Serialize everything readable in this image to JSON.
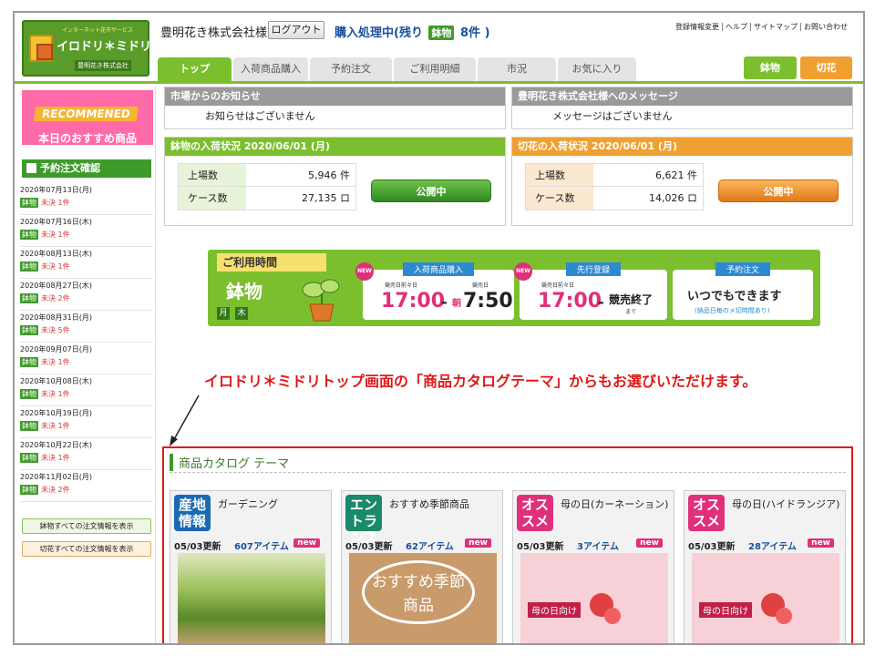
{
  "header": {
    "logo_tagline": "インターネット花市サービス",
    "logo_name": "イロドリ＊ミドリ",
    "logo_company": "豊明花き株式会社",
    "company_name": "豊明花き株式会社様",
    "logout_label": "ログアウト",
    "status_prefix": "購入処理中(残り",
    "status_tag": "鉢物",
    "status_count": "8件 )",
    "toplinks": [
      "登録情報変更",
      "ヘルプ",
      "サイトマップ",
      "お問い合わせ"
    ]
  },
  "tabs": [
    {
      "label": "トップ",
      "active": true
    },
    {
      "label": "入荷商品購入"
    },
    {
      "label": "予約注文"
    },
    {
      "label": "ご利用明細"
    },
    {
      "label": "市況"
    },
    {
      "label": "お気に入り"
    }
  ],
  "category_buttons": {
    "hachi": "鉢物",
    "kiri": "切花"
  },
  "sidebar": {
    "recommend_label": "RECOMMENED",
    "recommend_sub": "本日のおすすめ商品",
    "order_header": "予約注文確認",
    "orders": [
      {
        "date": "2020年07月13日(月)",
        "type": "鉢物",
        "status": "未決 1件"
      },
      {
        "date": "2020年07月16日(木)",
        "type": "鉢物",
        "status": "未決 1件"
      },
      {
        "date": "2020年08月13日(木)",
        "type": "鉢物",
        "status": "未決 1件"
      },
      {
        "date": "2020年08月27日(木)",
        "type": "鉢物",
        "status": "未決 2件"
      },
      {
        "date": "2020年08月31日(月)",
        "type": "鉢物",
        "status": "未決 5件"
      },
      {
        "date": "2020年09月07日(月)",
        "type": "鉢物",
        "status": "未決 1件"
      },
      {
        "date": "2020年10月08日(木)",
        "type": "鉢物",
        "status": "未決 1件"
      },
      {
        "date": "2020年10月19日(月)",
        "type": "鉢物",
        "status": "未決 1件"
      },
      {
        "date": "2020年10月22日(木)",
        "type": "鉢物",
        "status": "未決 1件"
      },
      {
        "date": "2020年11月02日(月)",
        "type": "鉢物",
        "status": "未決 2件"
      }
    ],
    "btn_hachi_all": "鉢物すべての注文情報を表示",
    "btn_kiri_all": "切花すべての注文情報を表示"
  },
  "notices": {
    "market_title": "市場からのお知らせ",
    "market_body": "お知らせはございません",
    "message_title": "豊明花き株式会社様へのメッセージ",
    "message_body": "メッセージはございません"
  },
  "arrivals": {
    "hachi_title": "鉢物の入荷状況 2020/06/01 (月)",
    "hachi_rows": [
      {
        "label": "上場数",
        "value": "5,946 件"
      },
      {
        "label": "ケース数",
        "value": "27,135 ロ"
      }
    ],
    "hachi_button": "公開中",
    "kiri_title": "切花の入荷状況 2020/06/01 (月)",
    "kiri_rows": [
      {
        "label": "上場数",
        "value": "6,621 件"
      },
      {
        "label": "ケース数",
        "value": "14,026 ロ"
      }
    ],
    "kiri_button": "公開中"
  },
  "banner": {
    "title": "ご利用時間",
    "kind": "鉢物",
    "days": [
      "月",
      "木"
    ],
    "box1_head": "入荷商品購入",
    "box1_sub1": "競売日前々日",
    "box1_sub2": "競売日",
    "box1_start": "17:00",
    "box1_dash": "-",
    "box1_asa": "朝",
    "box1_end": "7:50",
    "box2_head": "先行登録",
    "box2_sub1": "競売日前々日",
    "box2_start": "17:00",
    "box2_dash": "-",
    "box2_end": "競売終了",
    "box2_end_sub": "まで",
    "box3_head": "予約注文",
    "box3_main": "いつでもできます",
    "box3_note": "(納品日毎のメ切時間あり)",
    "new_label": "NEW"
  },
  "note": "イロドリ＊ミドリトップ画面の「商品カタログテーマ」からもお選びいただけます。",
  "catalog": {
    "title": "商品カタログ テーマ",
    "cards": [
      {
        "badge": "産地情報",
        "title": "ガーデニング",
        "updated": "05/03更新",
        "items": "607アイテム",
        "new": "new",
        "image_text": ""
      },
      {
        "badge": "エントランス",
        "title": "おすすめ季節商品",
        "updated": "05/03更新",
        "items": "62アイテム",
        "new": "new",
        "image_text": "おすすめ季節商品"
      },
      {
        "badge": "オススメ",
        "title": "母の日(カーネーション)",
        "updated": "05/03更新",
        "items": "3アイテム",
        "new": "new",
        "image_text": "母の日向け"
      },
      {
        "badge": "オススメ",
        "title": "母の日(ハイドランジア)",
        "updated": "05/03更新",
        "items": "28アイテム",
        "new": "new",
        "image_text": "母の日向け"
      }
    ]
  },
  "colors": {
    "brand_green": "#7bbf2e",
    "brand_orange": "#f0a030",
    "accent_red": "#e01818",
    "accent_pink": "#e0307a"
  }
}
